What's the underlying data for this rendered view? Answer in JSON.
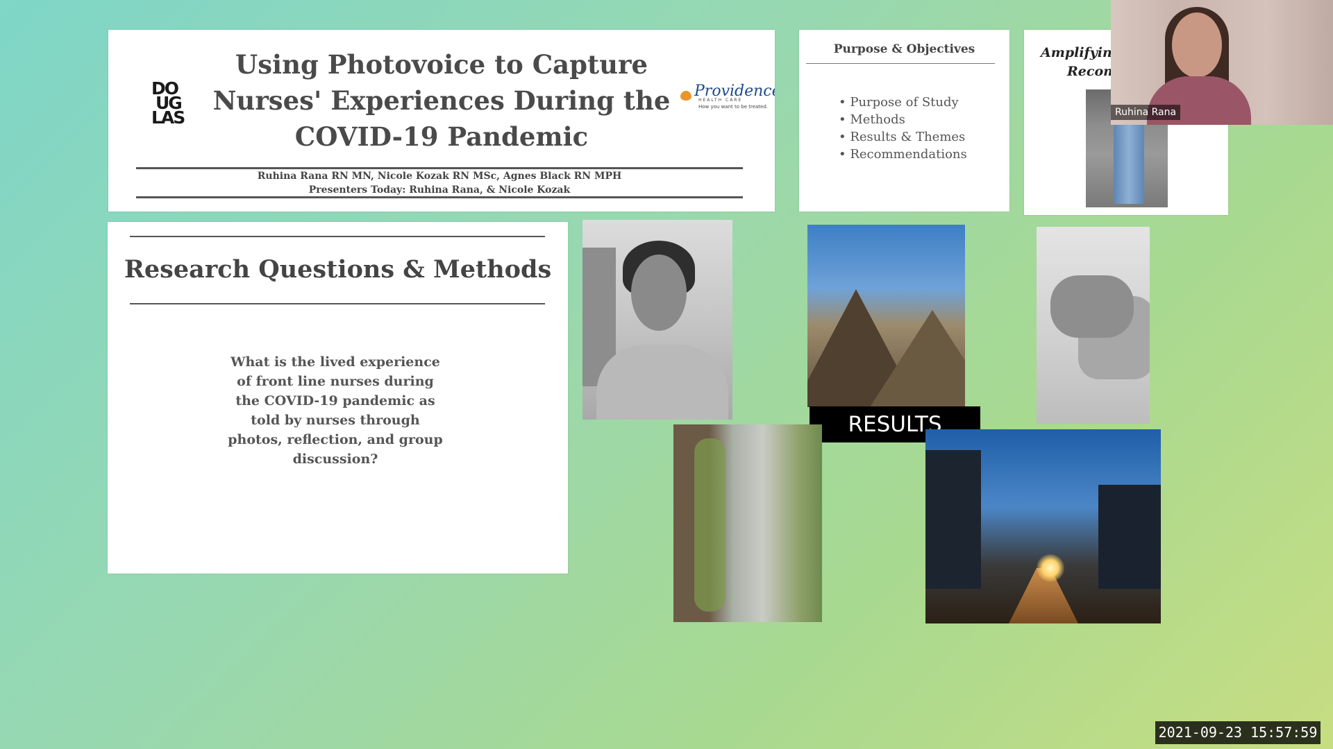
{
  "title_slide": {
    "logo_left": [
      "DO",
      "UG",
      "LAS"
    ],
    "title": "Using Photovoice to Capture Nurses' Experiences During the COVID-19 Pandemic",
    "logo_right": {
      "name": "Providence",
      "sub": "HEALTH CARE",
      "tagline": "How you want to be treated."
    },
    "authors": "Ruhina Rana RN MN, Nicole Kozak RN MSc, Agnes Black RN MPH",
    "presenters": "Presenters Today: Ruhina Rana, & Nicole Kozak"
  },
  "purpose_slide": {
    "heading": "Purpose & Objectives",
    "items": [
      "Purpose of Study",
      "Methods",
      "Results & Themes",
      "Recommendations"
    ]
  },
  "amplifying_slide": {
    "heading_line1": "Amplifying",
    "heading_line2": "Recom"
  },
  "webcam": {
    "participant_name": "Ruhina Rana"
  },
  "research_slide": {
    "heading": "Research Questions & Methods",
    "question": "What is the lived experience of front line nurses during the COVID-19 pandemic as told by nurses through photos, reflection, and group discussion?"
  },
  "results_slide": {
    "label": "RESULTS"
  },
  "timestamp": "2021-09-23  15:57:59",
  "colors": {
    "background_start": "#7fd6c7",
    "background_end": "#c7dd82",
    "title_text": "#4a4a4a",
    "providence_blue": "#1c4a8a"
  }
}
